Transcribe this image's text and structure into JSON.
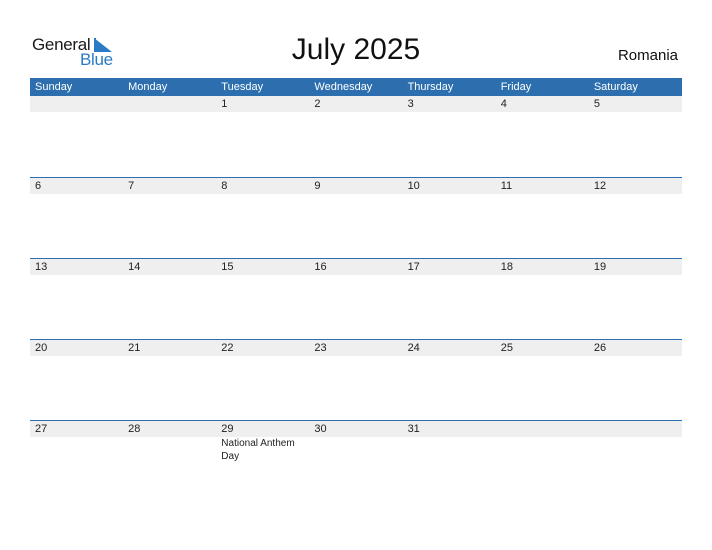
{
  "logo": {
    "general": "General",
    "blue": "Blue"
  },
  "title": "July 2025",
  "country": "Romania",
  "colors": {
    "accent": "#2d6fae",
    "logo_blue": "#2a7bc4",
    "date_strip": "#efefef"
  },
  "weekdays": [
    "Sunday",
    "Monday",
    "Tuesday",
    "Wednesday",
    "Thursday",
    "Friday",
    "Saturday"
  ],
  "weeks": [
    {
      "days": [
        "",
        "",
        "1",
        "2",
        "3",
        "4",
        "5"
      ]
    },
    {
      "days": [
        "6",
        "7",
        "8",
        "9",
        "10",
        "11",
        "12"
      ]
    },
    {
      "days": [
        "13",
        "14",
        "15",
        "16",
        "17",
        "18",
        "19"
      ]
    },
    {
      "days": [
        "20",
        "21",
        "22",
        "23",
        "24",
        "25",
        "26"
      ]
    },
    {
      "days": [
        "27",
        "28",
        "29",
        "30",
        "31",
        "",
        ""
      ]
    }
  ],
  "holidays": [
    {
      "date": "29",
      "name": "National Anthem Day"
    }
  ]
}
